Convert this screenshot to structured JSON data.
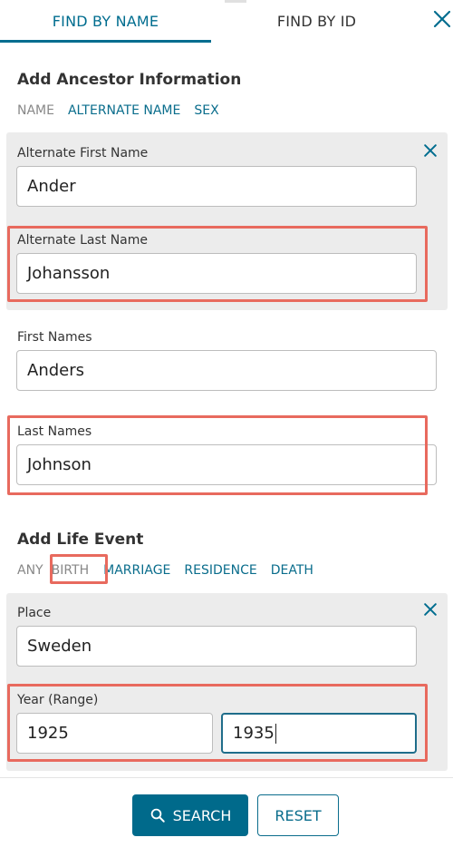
{
  "tabs": {
    "find_by_name": "FIND BY NAME",
    "find_by_id": "FIND BY ID"
  },
  "ancestor": {
    "title": "Add Ancestor Information",
    "nav": [
      "NAME",
      "ALTERNATE NAME",
      "SEX"
    ],
    "alternate": {
      "first_label": "Alternate First Name",
      "first_value": "Ander",
      "last_label": "Alternate Last Name",
      "last_value": "Johansson"
    },
    "first_label": "First Names",
    "first_value": "Anders",
    "last_label": "Last Names",
    "last_value": "Johnson"
  },
  "life_event": {
    "title": "Add Life Event",
    "nav": [
      "ANY",
      "BIRTH",
      "MARRIAGE",
      "RESIDENCE",
      "DEATH"
    ],
    "place_label": "Place",
    "place_value": "Sweden",
    "year_label": "Year (Range)",
    "year_from": "1925",
    "year_to": "1935"
  },
  "buttons": {
    "search": "SEARCH",
    "reset": "RESET"
  },
  "colors": {
    "accent": "#006d8f",
    "highlight": "#e86a5e",
    "panel": "#ececec"
  }
}
